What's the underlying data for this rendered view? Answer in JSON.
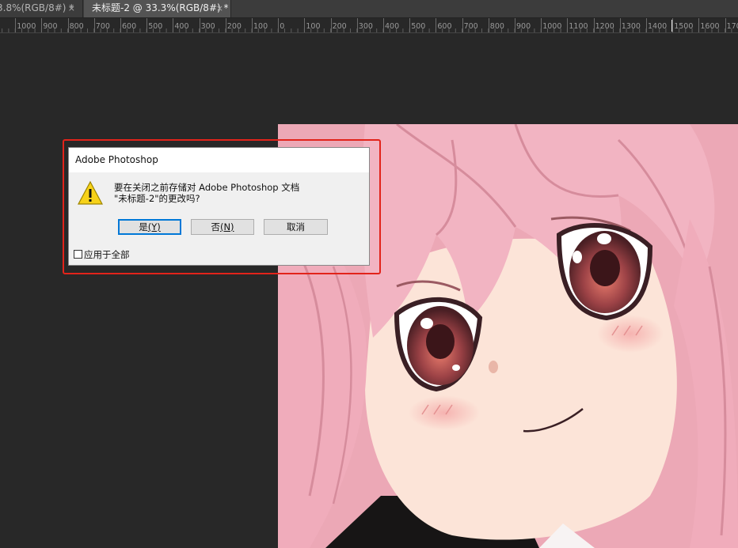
{
  "tabs": [
    {
      "label": "3.8%(RGB/8#) *",
      "active": false,
      "close": "×"
    },
    {
      "label": "未标题-2 @ 33.3%(RGB/8#) *",
      "active": true,
      "close": "×"
    }
  ],
  "ruler": {
    "labels": [
      "0",
      "1000",
      "900",
      "800",
      "700",
      "600",
      "500",
      "400",
      "300",
      "200",
      "100",
      "0",
      "100",
      "200",
      "300",
      "400",
      "500",
      "600",
      "700",
      "800",
      "900",
      "1000",
      "1100",
      "1200",
      "1300",
      "1400",
      "1500",
      "1600",
      "170"
    ]
  },
  "dialog": {
    "title": "Adobe Photoshop",
    "message_line1": "要在关闭之前存储对 Adobe Photoshop 文档",
    "message_line2": "\"未标题-2\"的更改吗?",
    "yes_text": "是",
    "yes_key": "(Y)",
    "no_text": "否",
    "no_key": "(N)",
    "cancel_label": "取消",
    "apply_all_label": "应用于全部",
    "apply_all_checked": false
  },
  "colors": {
    "highlight": "#e2231a",
    "hair": "#f2b6c4",
    "skin": "#fbe3d7",
    "eye": "#7b3336"
  }
}
